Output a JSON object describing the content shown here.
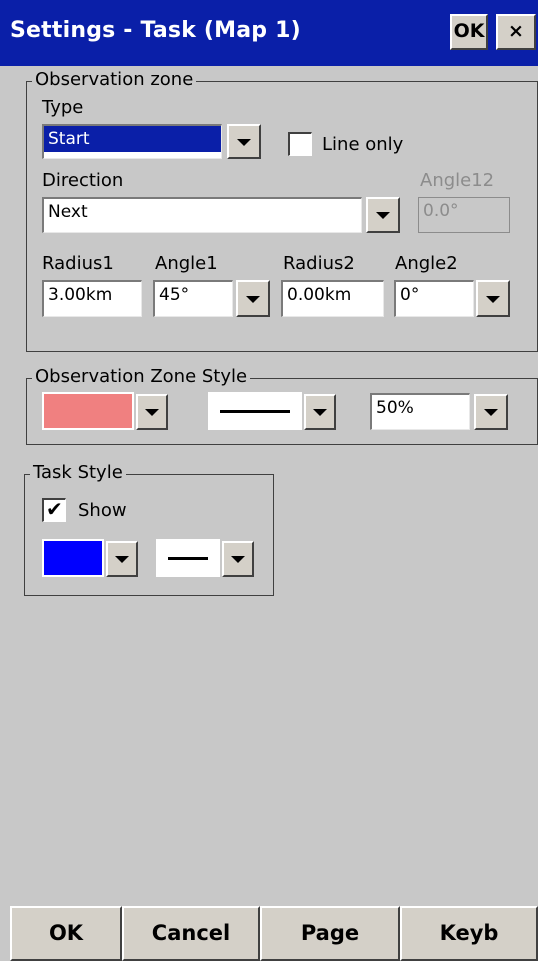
{
  "titlebar": {
    "title": "Settings - Task (Map 1)",
    "ok_label": "OK",
    "close_label": "×"
  },
  "observation_zone": {
    "legend": "Observation zone",
    "type_label": "Type",
    "type_value": "Start",
    "line_only_label": "Line only",
    "line_only_checked": false,
    "direction_label": "Direction",
    "direction_value": "Next",
    "angle12_label": "Angle12",
    "angle12_value": "0.0°",
    "radius1_label": "Radius1",
    "radius1_value": "3.00km",
    "angle1_label": "Angle1",
    "angle1_value": "45°",
    "radius2_label": "Radius2",
    "radius2_value": "0.00km",
    "angle2_label": "Angle2",
    "angle2_value": "0°"
  },
  "zone_style": {
    "legend": "Observation Zone Style",
    "color": "#f08080",
    "opacity_value": "50%"
  },
  "task_style": {
    "legend": "Task Style",
    "show_label": "Show",
    "show_checked": true,
    "check_glyph": "✔",
    "color": "#0000ff"
  },
  "bottom": {
    "ok": "OK",
    "cancel": "Cancel",
    "page": "Page",
    "keyb": "Keyb"
  }
}
